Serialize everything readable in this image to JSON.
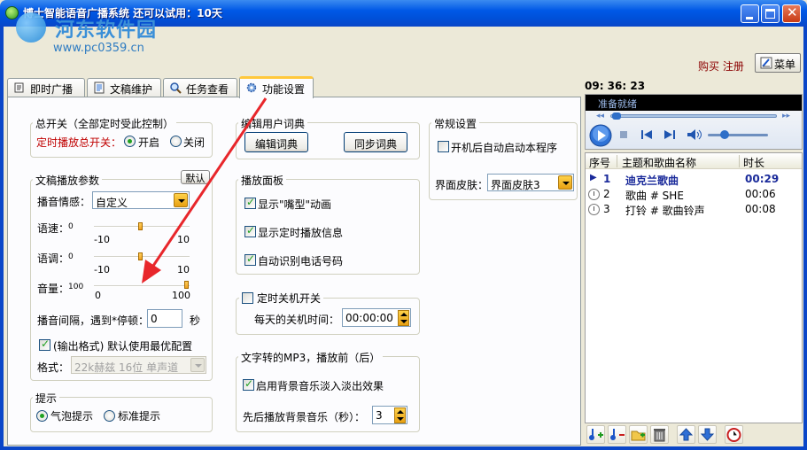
{
  "window": {
    "title": "博士智能语音广播系统  还可以试用：10天"
  },
  "watermark": {
    "site_name": "河东软件园",
    "url": "www.pc0359.cn"
  },
  "topbar": {
    "buy_register": "购买 注册",
    "menu_label": "菜单"
  },
  "tabs": [
    {
      "label": "即时广播",
      "icon": "broadcast-icon"
    },
    {
      "label": "文稿维护",
      "icon": "document-icon"
    },
    {
      "label": "任务查看",
      "icon": "magnifier-icon"
    },
    {
      "label": "功能设置",
      "icon": "gear-icon",
      "active": true
    }
  ],
  "master_switch": {
    "title": "总开关（全部定时受此控制）",
    "label": "定时播放总开关：",
    "options": [
      "开启",
      "关闭"
    ],
    "selected": "开启"
  },
  "doc_playback": {
    "title": "文稿播放参数",
    "default_button": "默认",
    "emotion_label": "播音情感：",
    "emotion_value": "自定义",
    "speed_label": "语速：",
    "speed_value": "0",
    "speed_min": "-10",
    "speed_max": "10",
    "pitch_label": "语调：",
    "pitch_value": "0",
    "pitch_min": "-10",
    "pitch_max": "10",
    "volume_label": "音量：",
    "volume_value": "100",
    "volume_min": "0",
    "volume_max": "100",
    "interval_label": "播音间隔，遇到*停顿：",
    "interval_value": "0",
    "interval_unit": "秒",
    "output_format_check_label": "(输出格式) 默认使用最优配置",
    "output_format_checked": true,
    "format_label": "格式：",
    "format_value": "22k赫兹 16位 单声道"
  },
  "hint": {
    "title": "提示",
    "options": [
      "气泡提示",
      "标准提示"
    ],
    "selected": "气泡提示"
  },
  "user_dict": {
    "title": "编辑用户词典",
    "edit_button": "编辑词典",
    "sync_button": "同步词典"
  },
  "play_panel": {
    "title": "播放面板",
    "options": [
      {
        "label": "显示\"嘴型\"动画",
        "checked": true
      },
      {
        "label": "显示定时播放信息",
        "checked": true
      },
      {
        "label": "自动识别电话号码",
        "checked": true
      }
    ]
  },
  "shutdown": {
    "title": "定时关机开关",
    "checked": false,
    "time_label": "每天的关机时间：",
    "time_value": "00:00:00"
  },
  "mp3": {
    "title": "文字转的MP3，播放前（后）",
    "fade_label": "启用背景音乐淡入淡出效果",
    "fade_checked": true,
    "bg_label": "先后播放背景音乐（秒）：",
    "bg_value": "3"
  },
  "general": {
    "title": "常规设置",
    "autostart_label": "开机后自动启动本程序",
    "autostart_checked": false,
    "skin_label": "界面皮肤：",
    "skin_value": "界面皮肤3"
  },
  "player": {
    "clock": "09: 36: 23",
    "status": "准备就绪"
  },
  "playlist": {
    "headers": [
      "序号",
      "主题和歌曲名称",
      "时长"
    ],
    "rows": [
      {
        "index": "1",
        "title": "迪克兰歌曲",
        "duration": "00:29",
        "playing": true
      },
      {
        "index": "2",
        "title": "歌曲 # SHE",
        "duration": "00:06",
        "playing": false
      },
      {
        "index": "3",
        "title": "打铃 # 歌曲铃声",
        "duration": "00:08",
        "playing": false
      }
    ]
  },
  "colors": {
    "titlebar": "#0058e6",
    "frame": "#0a46c8",
    "tab_accent": "#ffc83c",
    "red_label": "#c00000",
    "annotation_arrow": "#e8262b",
    "playing_row": "#1a2a9a"
  }
}
